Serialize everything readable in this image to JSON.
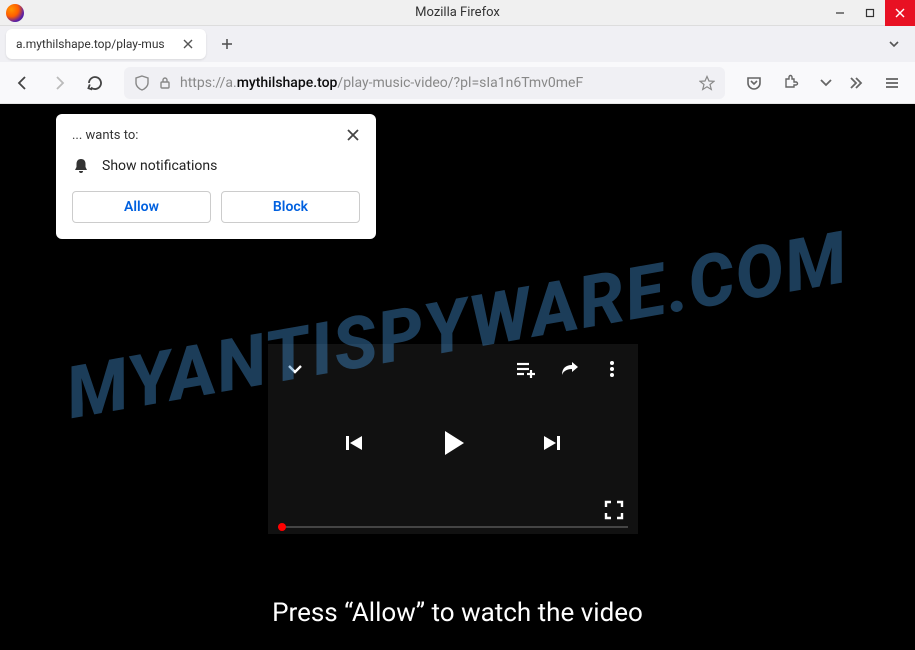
{
  "window": {
    "title": "Mozilla Firefox"
  },
  "tab": {
    "title": "a.mythilshape.top/play-mus"
  },
  "url": {
    "proto": "https://",
    "sub": "a.",
    "domain": "mythilshape.top",
    "path": "/play-music-video/?pl=sIa1n6Tmv0meF"
  },
  "notification": {
    "wants": "... wants to:",
    "permission": "Show notifications",
    "allow": "Allow",
    "block": "Block"
  },
  "page": {
    "instruction": "Press “Allow” to watch the video"
  },
  "watermark": "MYANTISPYWARE.COM"
}
